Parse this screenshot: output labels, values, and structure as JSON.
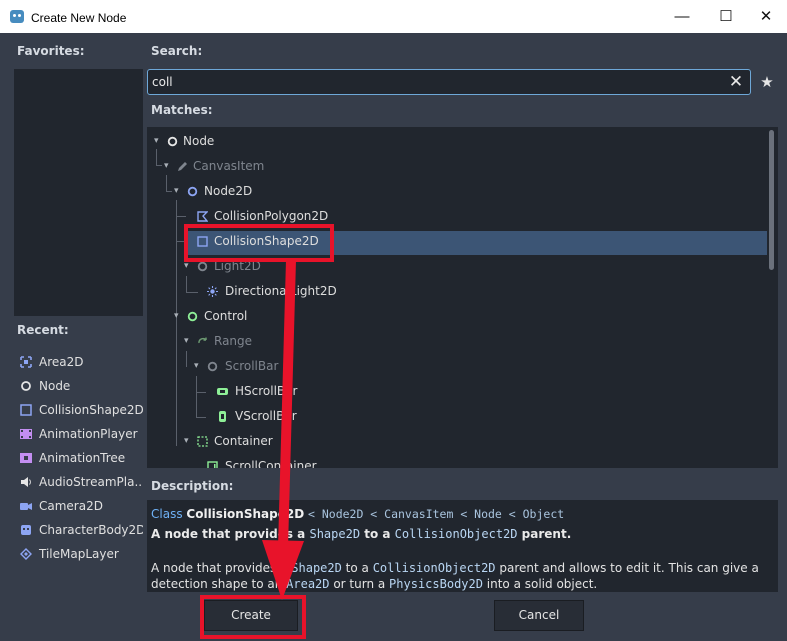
{
  "window": {
    "title": "Create New Node",
    "minimize_glyph": "—",
    "maximize_glyph": "☐",
    "close_glyph": "✕"
  },
  "favorites": {
    "label": "Favorites:"
  },
  "search": {
    "label": "Search:",
    "value": "coll",
    "clear_glyph": "✕",
    "star_glyph": "★"
  },
  "matches": {
    "label": "Matches:",
    "rows": [
      {
        "label": "Node",
        "icon": "node-circle-icon",
        "dim": false
      },
      {
        "label": "CanvasItem",
        "icon": "pencil-icon",
        "dim": true
      },
      {
        "label": "Node2D",
        "icon": "node2d-circle-icon",
        "dim": false
      },
      {
        "label": "CollisionPolygon2D",
        "icon": "collision-polygon-icon",
        "dim": false
      },
      {
        "label": "CollisionShape2D",
        "icon": "collision-shape-icon",
        "dim": false,
        "selected": true
      },
      {
        "label": "Light2D",
        "icon": "light2d-circle-icon",
        "dim": true
      },
      {
        "label": "DirectionalLight2D",
        "icon": "sun-icon",
        "dim": false
      },
      {
        "label": "Control",
        "icon": "control-circle-icon",
        "dim": false
      },
      {
        "label": "Range",
        "icon": "range-icon",
        "dim": true
      },
      {
        "label": "ScrollBar",
        "icon": "scrollbar-circle-icon",
        "dim": true
      },
      {
        "label": "HScrollBar",
        "icon": "hscrollbar-icon",
        "dim": false
      },
      {
        "label": "VScrollBar",
        "icon": "vscrollbar-icon",
        "dim": false
      },
      {
        "label": "Container",
        "icon": "container-icon",
        "dim": false
      },
      {
        "label": "ScrollContainer",
        "icon": "scrollcontainer-icon",
        "dim": false
      }
    ]
  },
  "recent": {
    "label": "Recent:",
    "items": [
      {
        "label": "Area2D",
        "icon": "area2d-icon"
      },
      {
        "label": "Node",
        "icon": "node-circle-icon"
      },
      {
        "label": "CollisionShape2D",
        "icon": "collision-shape-icon"
      },
      {
        "label": "AnimationPlayer",
        "icon": "animation-player-icon"
      },
      {
        "label": "AnimationTree",
        "icon": "animation-tree-icon"
      },
      {
        "label": "AudioStreamPla...",
        "icon": "speaker-icon"
      },
      {
        "label": "Camera2D",
        "icon": "camera-icon"
      },
      {
        "label": "CharacterBody2D",
        "icon": "character-body-icon"
      },
      {
        "label": "TileMapLayer",
        "icon": "tilemap-icon"
      }
    ]
  },
  "description": {
    "label": "Description:",
    "class_kw": "Class",
    "class_name": "CollisionShape2D",
    "inheritance": "< Node2D < CanvasItem < Node < Object",
    "summary_1": "A node that provides a ",
    "summary_code_1": "Shape2D",
    "summary_2": " to a ",
    "summary_code_2": "CollisionObject2D",
    "summary_3": " parent.",
    "body_1": "A node that provides a ",
    "body_code_1": "Shape2D",
    "body_2": " to a ",
    "body_code_2": "CollisionObject2D",
    "body_3": " parent and allows to edit it. This can give a",
    "body_4": "detection shape to an ",
    "body_code_3": "Area2D",
    "body_5": " or turn a ",
    "body_code_4": "PhysicsBody2D",
    "body_6": " into a solid object."
  },
  "buttons": {
    "create": "Create",
    "cancel": "Cancel"
  },
  "colors": {
    "annotation_red": "#e8132a",
    "selection_blue": "#3c5575",
    "accent_blue": "#6ea8d8"
  }
}
